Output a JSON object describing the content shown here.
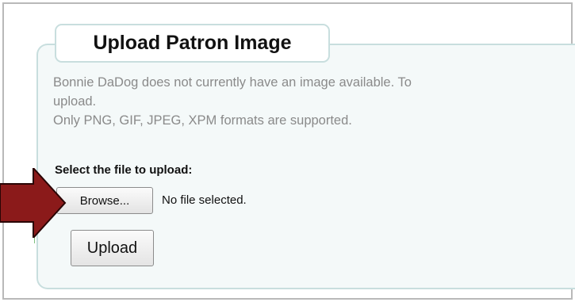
{
  "dialog": {
    "title": "Upload Patron Image",
    "info_lines": [
      "Bonnie DaDog does not currently have an image available. To",
      "upload.",
      "Only PNG, GIF, JPEG, XPM formats are supported."
    ],
    "select_label": "Select the file to upload:",
    "browse_label": "Browse...",
    "file_status": "No file selected.",
    "upload_label": "Upload"
  },
  "colors": {
    "panel_border": "#c8dede",
    "panel_background": "#f4f9f9",
    "arrow": "#8b1a1a",
    "info_text": "#8a8a8a"
  },
  "icons": {
    "pointer": "callout-arrow-right"
  }
}
